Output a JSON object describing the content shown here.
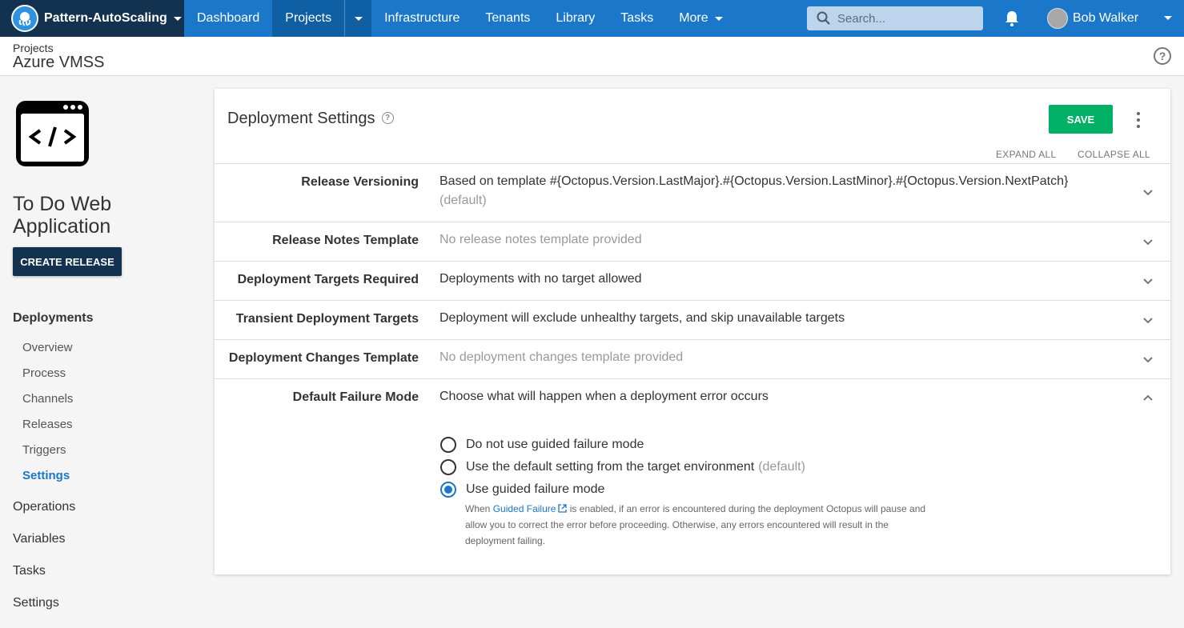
{
  "topnav": {
    "space_name": "Pattern-AutoScaling",
    "items": {
      "dashboard": "Dashboard",
      "projects": "Projects",
      "infrastructure": "Infrastructure",
      "tenants": "Tenants",
      "library": "Library",
      "tasks": "Tasks",
      "more": "More"
    },
    "search_placeholder": "Search...",
    "user_name": "Bob Walker"
  },
  "header": {
    "breadcrumb": "Projects",
    "title": "Azure VMSS"
  },
  "sidebar": {
    "project_name": "To Do Web Application",
    "create_release": "CREATE RELEASE",
    "deployments_heading": "Deployments",
    "deployments_items": {
      "overview": "Overview",
      "process": "Process",
      "channels": "Channels",
      "releases": "Releases",
      "triggers": "Triggers",
      "settings": "Settings"
    },
    "operations": "Operations",
    "variables": "Variables",
    "tasks": "Tasks",
    "settings": "Settings"
  },
  "card": {
    "title": "Deployment Settings",
    "save": "SAVE",
    "expand_all": "EXPAND ALL",
    "collapse_all": "COLLAPSE ALL",
    "rows": {
      "release_versioning": {
        "label": "Release Versioning",
        "value": "Based on template #{Octopus.Version.LastMajor}.#{Octopus.Version.LastMinor}.#{Octopus.Version.NextPatch}",
        "note": "(default)"
      },
      "release_notes": {
        "label": "Release Notes Template",
        "value": "No release notes template provided"
      },
      "targets_required": {
        "label": "Deployment Targets Required",
        "value": "Deployments with no target allowed"
      },
      "transient_targets": {
        "label": "Transient Deployment Targets",
        "value": "Deployment will exclude unhealthy targets, and skip unavailable targets"
      },
      "changes_template": {
        "label": "Deployment Changes Template",
        "value": "No deployment changes template provided"
      },
      "failure_mode": {
        "label": "Default Failure Mode",
        "value": "Choose what will happen when a deployment error occurs",
        "options": {
          "off": "Do not use guided failure mode",
          "env": "Use the default setting from the target environment",
          "env_note": "(default)",
          "on": "Use guided failure mode"
        },
        "selected": "Use guided failure mode",
        "hint_pre": "When",
        "hint_link": "Guided Failure",
        "hint_post": "is enabled, if an error is encountered during the deployment Octopus will pause and allow you to correct the error before proceeding. Otherwise, any errors encountered will result in the deployment failing."
      }
    }
  },
  "colors": {
    "nav_blue": "#1a77ca",
    "space_dark": "#13324f",
    "save_green": "#00b065"
  }
}
